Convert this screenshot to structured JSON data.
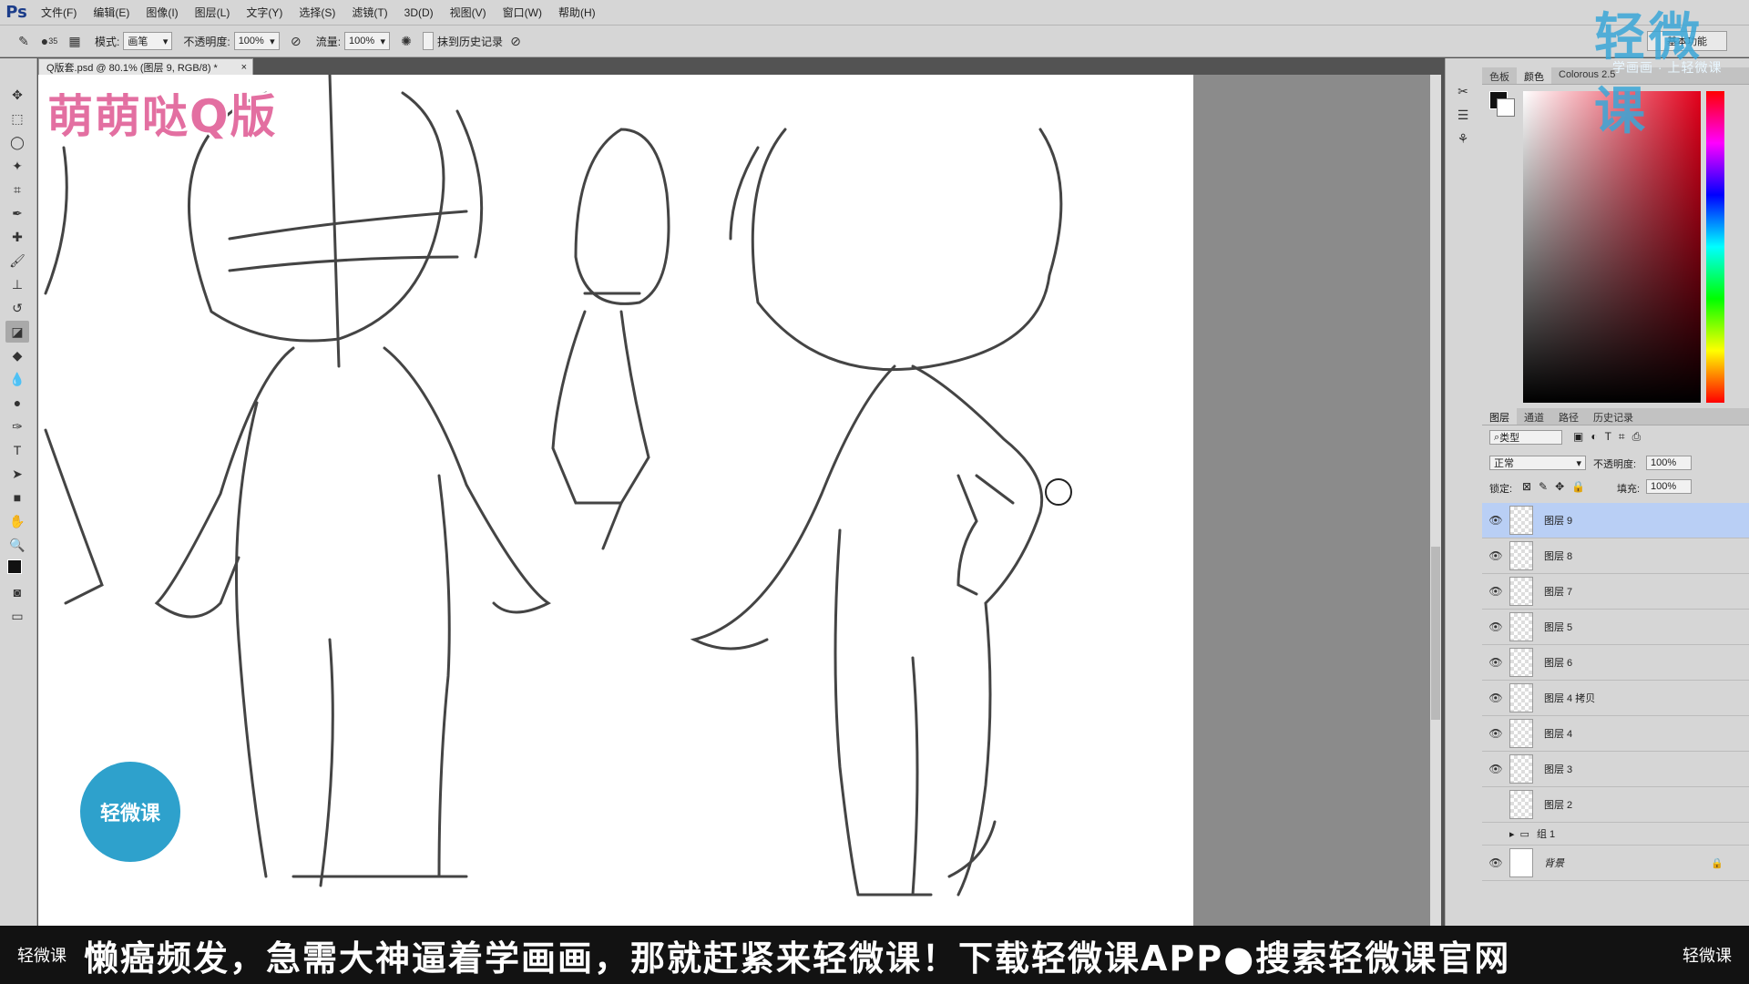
{
  "app": {
    "logo": "Ps"
  },
  "menu": [
    "文件(F)",
    "编辑(E)",
    "图像(I)",
    "图层(L)",
    "文字(Y)",
    "选择(S)",
    "滤镜(T)",
    "3D(D)",
    "视图(V)",
    "窗口(W)",
    "帮助(H)"
  ],
  "brand": {
    "top": "轻微课",
    "sub": "学画画 · 上轻微课"
  },
  "options": {
    "brush_size": "35",
    "mode_label": "模式:",
    "mode_value": "画笔",
    "opacity_label": "不透明度:",
    "opacity_value": "100%",
    "flow_label": "流量:",
    "flow_value": "100%",
    "history_label": "抹到历史记录",
    "workspace": "基本功能"
  },
  "document": {
    "tab": "Q版套.psd @ 80.1% (图层 9, RGB/8) *",
    "close": "×"
  },
  "canvas": {
    "logo": "萌萌哒Q版",
    "badge": "轻微课"
  },
  "color_panel": {
    "tabs": [
      "色板",
      "颜色",
      "Colorous 2.5"
    ],
    "fg": "#111111",
    "bg": "#ffffff"
  },
  "layers_panel": {
    "tabs": [
      "图层",
      "通道",
      "路径",
      "历史记录"
    ],
    "filter": "类型",
    "blend": "正常",
    "opacity_label": "不透明度:",
    "opacity_value": "100%",
    "lock_label": "锁定:",
    "fill_label": "填充:",
    "fill_value": "100%",
    "layers": [
      {
        "name": "图层 9",
        "visible": true,
        "selected": true
      },
      {
        "name": "图层 8",
        "visible": true
      },
      {
        "name": "图层 7",
        "visible": true
      },
      {
        "name": "图层 5",
        "visible": true
      },
      {
        "name": "图层 6",
        "visible": true
      },
      {
        "name": "图层 4 拷贝",
        "visible": true
      },
      {
        "name": "图层 4",
        "visible": true
      },
      {
        "name": "图层 3",
        "visible": true
      },
      {
        "name": "图层 2",
        "visible": false
      },
      {
        "name": "组 1",
        "visible": false,
        "group": true
      },
      {
        "name": "背景",
        "visible": true,
        "locked": true
      }
    ]
  },
  "banner": {
    "left": "轻微课",
    "text": "懒癌频发，急需大神逼着学画画，那就赶紧来轻微课！下载轻微课APP●搜索轻微课官网",
    "right": "轻微课"
  }
}
